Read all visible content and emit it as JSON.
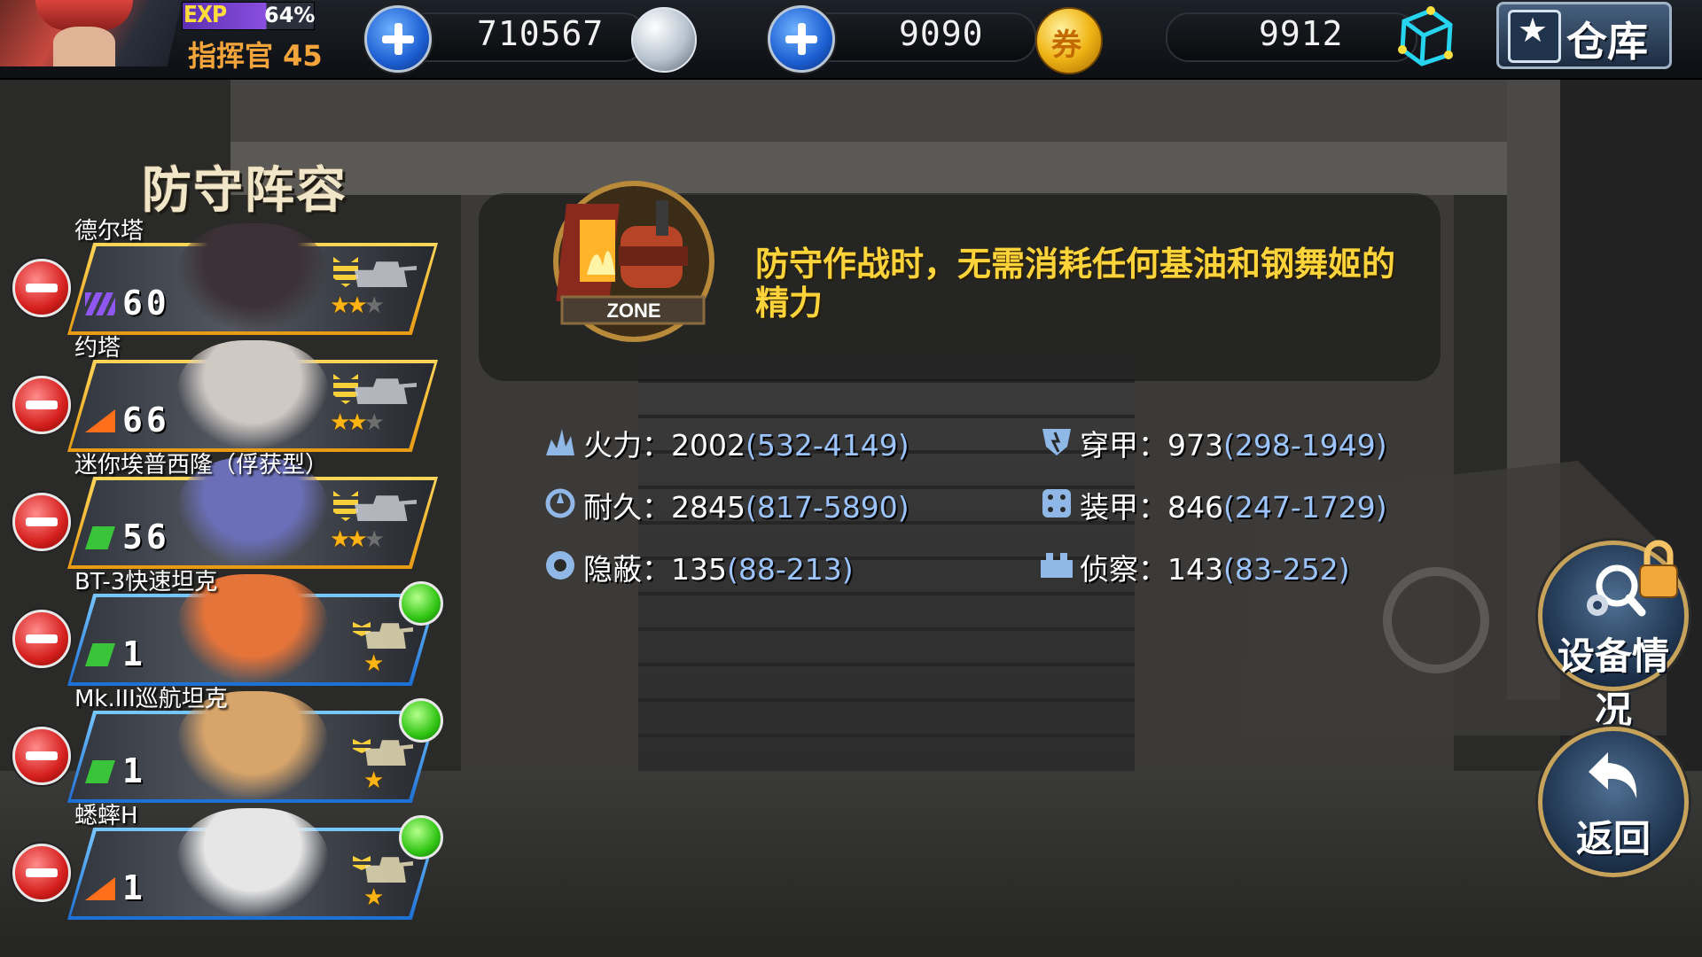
{
  "player": {
    "exp_label": "EXP",
    "exp_percent": "64%",
    "exp_fraction": 0.64,
    "rank_title": "指挥官 45"
  },
  "resources": {
    "silver": "710567",
    "gold": "9090",
    "gold_coin_glyph": "券",
    "cube": "9912"
  },
  "warehouse_button": {
    "label": "仓库",
    "icon": "star-box-icon"
  },
  "left_panel": {
    "title": "防守阵容",
    "members": [
      {
        "name": "德尔塔",
        "level": "60",
        "class_icon": "purple-triple-icon",
        "class_color": "#8f56f0",
        "stars_on": 2,
        "stars_total": 3,
        "frame": "gold",
        "has_new": false,
        "art_color": "#3c3136"
      },
      {
        "name": "约塔",
        "level": "66",
        "class_icon": "orange-ramp-icon",
        "class_color": "#ff6e1a",
        "stars_on": 2,
        "stars_total": 3,
        "frame": "gold",
        "has_new": false,
        "art_color": "#cfc9c4"
      },
      {
        "name": "迷你埃普西隆（俘获型）",
        "level": "56",
        "class_icon": "green-bar-icon",
        "class_color": "#39c43a",
        "stars_on": 2,
        "stars_total": 3,
        "frame": "gold",
        "has_new": false,
        "art_color": "#6a6fb8"
      },
      {
        "name": "BT-3快速坦克",
        "level": "1",
        "class_icon": "green-bar-icon",
        "class_color": "#39c43a",
        "stars_on": 1,
        "stars_total": 1,
        "frame": "blue",
        "has_new": true,
        "art_color": "#e5743a"
      },
      {
        "name": "Mk.III巡航坦克",
        "level": "1",
        "class_icon": "green-bar-icon",
        "class_color": "#39c43a",
        "stars_on": 1,
        "stars_total": 1,
        "frame": "blue",
        "has_new": true,
        "art_color": "#d7a46a"
      },
      {
        "name": "蟋蟀H",
        "level": "1",
        "class_icon": "orange-ramp-icon",
        "class_color": "#ff6e1a",
        "stars_on": 1,
        "stars_total": 1,
        "frame": "blue",
        "has_new": true,
        "art_color": "#e6e6e6"
      }
    ]
  },
  "zone": {
    "badge_label": "ZONE",
    "description": "防守作战时，无需消耗任何基油和钢舞姬的精力"
  },
  "stats": [
    {
      "icon": "firepower-icon",
      "label": "火力：",
      "value": "2002",
      "range": "(532-4149)"
    },
    {
      "icon": "durability-icon",
      "label": "耐久：",
      "value": "2845",
      "range": "(817-5890)"
    },
    {
      "icon": "stealth-icon",
      "label": "隐蔽：",
      "value": "135",
      "range": "(88-213)"
    },
    {
      "icon": "penetration-icon",
      "label": "穿甲：",
      "value": "973",
      "range": "(298-1949)"
    },
    {
      "icon": "armor-icon",
      "label": "装甲：",
      "value": "846",
      "range": "(247-1729)"
    },
    {
      "icon": "recon-icon",
      "label": "侦察：",
      "value": "143",
      "range": "(83-252)"
    }
  ],
  "buttons": {
    "equipment_status": "设备情况",
    "back": "返回"
  }
}
